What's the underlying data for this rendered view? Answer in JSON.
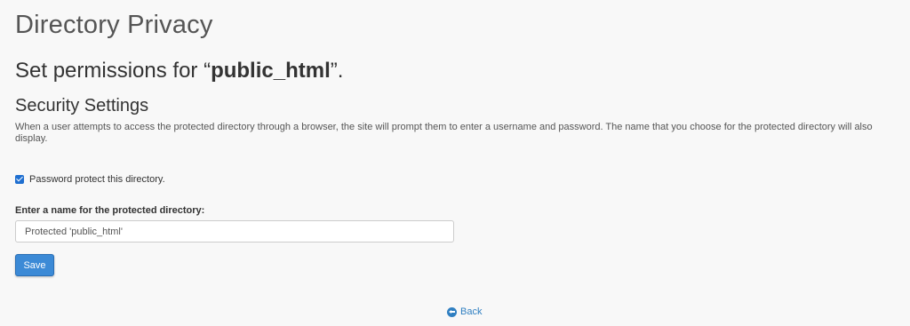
{
  "page": {
    "title": "Directory Privacy"
  },
  "permissions": {
    "prefix": "Set permissions for “",
    "directory": "public_html",
    "suffix": "”."
  },
  "security": {
    "title": "Security Settings",
    "description": "When a user attempts to access the protected directory through a browser, the site will prompt them to enter a username and password. The name that you choose for the protected directory will also display."
  },
  "protect_checkbox": {
    "label": "Password protect this directory.",
    "checked": true
  },
  "name_field": {
    "label": "Enter a name for the protected directory:",
    "value": "Protected 'public_html'"
  },
  "actions": {
    "save_label": "Save",
    "back_label": "Back"
  },
  "colors": {
    "accent": "#3c8ad6",
    "link": "#2f7fc1",
    "background": "#f8f8f8"
  },
  "icons": {
    "checkbox": "checkbox-checked-icon",
    "back": "arrow-circle-left-icon"
  }
}
